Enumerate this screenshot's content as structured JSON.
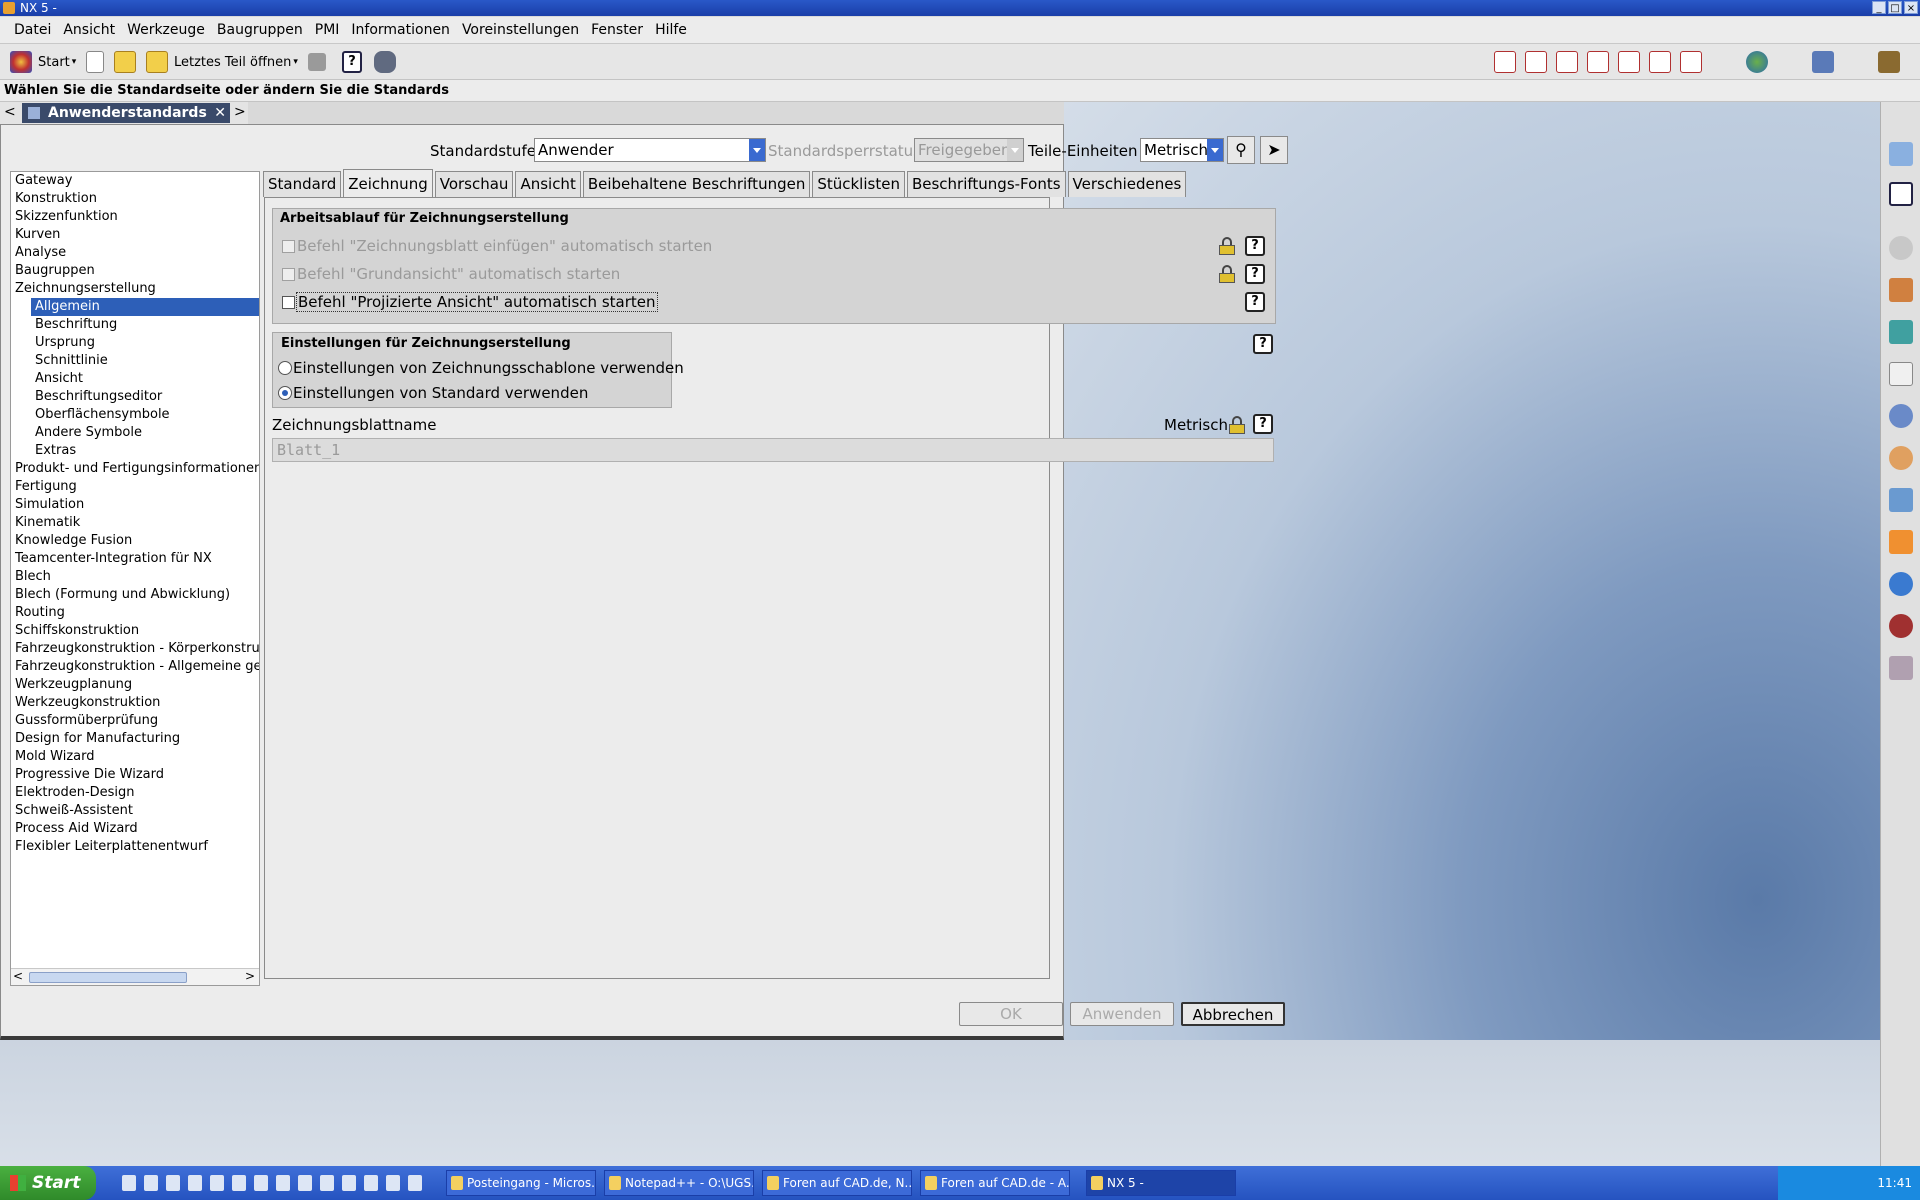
{
  "window": {
    "title": "NX 5 -"
  },
  "menu": [
    "Datei",
    "Ansicht",
    "Werkzeuge",
    "Baugruppen",
    "PMI",
    "Informationen",
    "Voreinstellungen",
    "Fenster",
    "Hilfe"
  ],
  "toolbar": {
    "start_label": "Start",
    "last_part_label": "Letztes Teil öffnen"
  },
  "status": {
    "cue": "Wählen Sie die Standardseite oder ändern Sie die Standards"
  },
  "resource_tab": {
    "title": "Anwenderstandards"
  },
  "header": {
    "level_label": "Standardstufe",
    "level_value": "Anwender",
    "lock_status_label": "Standardsperrstatus",
    "lock_status_value": "Freigegeben",
    "units_label": "Teile-Einheiten",
    "units_value": "Metrisch"
  },
  "tree": {
    "items_before": [
      "Gateway",
      "Konstruktion",
      "Skizzenfunktion",
      "Kurven",
      "Analyse",
      "Baugruppen",
      "Zeichnungserstellung"
    ],
    "selected": "Allgemein",
    "children": [
      "Beschriftung",
      "Ursprung",
      "Schnittlinie",
      "Ansicht",
      "Beschriftungseditor",
      "Oberflächensymbole",
      "Andere Symbole",
      "Extras"
    ],
    "items_after": [
      "Produkt- und Fertigungsinformationen",
      "Fertigung",
      "Simulation",
      "Kinematik",
      "Knowledge Fusion",
      "Teamcenter-Integration für NX",
      "Blech",
      "Blech (Formung und Abwicklung)",
      "Routing",
      "Schiffskonstruktion",
      "Fahrzeugkonstruktion - Körperkonstru",
      "Fahrzeugkonstruktion - Allgemeine ge",
      "Werkzeugplanung",
      "Werkzeugkonstruktion",
      "Gussformüberprüfung",
      "Design for Manufacturing",
      "Mold Wizard",
      "Progressive Die Wizard",
      "Elektroden-Design",
      "Schweiß-Assistent",
      "Process Aid Wizard",
      "Flexibler Leiterplattenentwurf"
    ]
  },
  "tabs": [
    "Standard",
    "Zeichnung",
    "Vorschau",
    "Ansicht",
    "Beibehaltene Beschriftungen",
    "Stücklisten",
    "Beschriftungs-Fonts",
    "Verschiedenes"
  ],
  "active_tab": "Zeichnung",
  "workflow": {
    "title": "Arbeitsablauf für Zeichnungserstellung",
    "opt1": "Befehl \"Zeichnungsblatt einfügen\" automatisch starten",
    "opt2": "Befehl \"Grundansicht\" automatisch starten",
    "opt3": "Befehl \"Projizierte Ansicht\" automatisch starten"
  },
  "settings": {
    "title": "Einstellungen für Zeichnungserstellung",
    "radio1": "Einstellungen von Zeichnungsschablone verwenden",
    "radio2": "Einstellungen von Standard verwenden",
    "selected": "radio2"
  },
  "sheet": {
    "label": "Zeichnungsblattname",
    "unit": "Metrisch",
    "value": "Blatt_1"
  },
  "help_glyph": "?",
  "buttons": {
    "ok": "OK",
    "apply": "Anwenden",
    "cancel": "Abbrechen"
  },
  "taskbar": {
    "start": "Start",
    "tasks": [
      "Posteingang - Micros...",
      "Notepad++ - O:\\UGS...",
      "Foren auf CAD.de, N...",
      "Foren auf CAD.de - A...",
      "NX 5 -"
    ],
    "clock": "11:41"
  }
}
